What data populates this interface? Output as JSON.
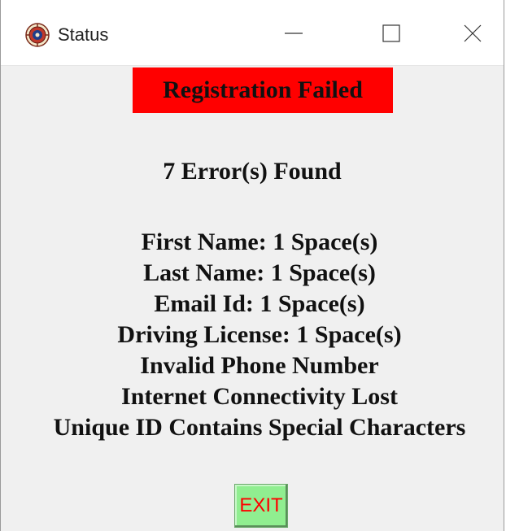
{
  "window": {
    "title": "Status",
    "controls": {
      "minimize": "minimize-icon",
      "maximize": "maximize-icon",
      "close": "close-icon"
    }
  },
  "status": {
    "banner": "Registration Failed",
    "banner_color": "#ff0000",
    "error_count": "7 Error(s) Found",
    "errors": [
      "First Name: 1 Space(s)",
      "Last Name: 1 Space(s)",
      "Email Id: 1 Space(s)",
      "Driving License: 1 Space(s)",
      "Invalid Phone Number",
      "Internet Connectivity Lost",
      "Unique ID Contains Special Characters"
    ]
  },
  "actions": {
    "exit_label": "EXIT",
    "exit_bg": "#90ee90",
    "exit_fg": "#ff0000"
  }
}
